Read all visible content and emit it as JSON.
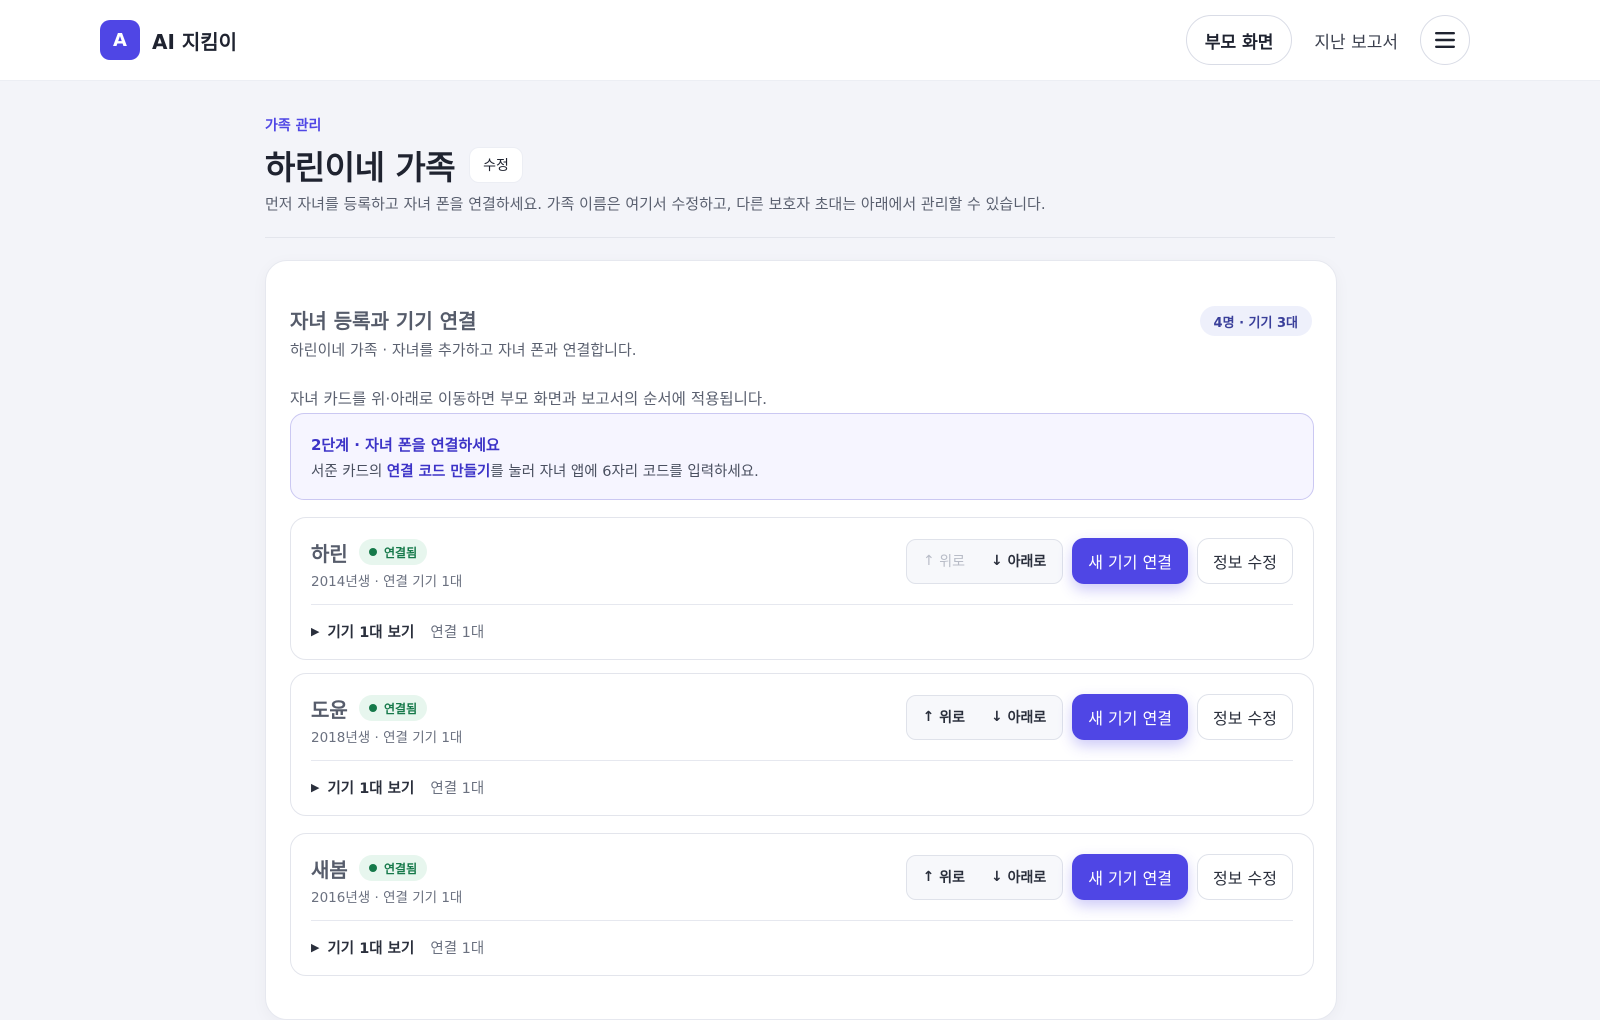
{
  "header": {
    "logo_letter": "A",
    "app_name": "AI 지킴이",
    "nav": {
      "parent_screen": "부모 화면",
      "past_reports": "지난 보고서"
    }
  },
  "page": {
    "eyebrow": "가족 관리",
    "title": "하린이네 가족",
    "edit_label": "수정",
    "description": "먼저 자녀를 등록하고 자녀 폰을 연결하세요. 가족 이름은 여기서 수정하고, 다른 보호자 초대는 아래에서 관리할 수 있습니다."
  },
  "section": {
    "title": "자녀 등록과 기기 연결",
    "subtitle": "하린이네 가족 · 자녀를 추가하고 자녀 폰과 연결합니다.",
    "count_badge": "4명 · 기기 3대",
    "order_note": "자녀 카드를 위·아래로 이동하면 부모 화면과 보고서의 순서에 적용됩니다."
  },
  "step": {
    "title": "2단계 · 자녀 폰을 연결하세요",
    "desc_prefix": "서준 카드의 ",
    "desc_highlight": "연결 코드 만들기",
    "desc_suffix": "를 눌러 자녀 앱에 6자리 코드를 입력하세요."
  },
  "children": [
    {
      "name": "하린",
      "status": "연결됨",
      "meta": "2014년생 · 연결 기기 1대",
      "up_label": "위로",
      "down_label": "아래로",
      "up_disabled": true,
      "connect_label": "새 기기 연결",
      "edit_label": "정보 수정",
      "devices_toggle": "기기 1대 보기",
      "devices_count": "연결 1대"
    },
    {
      "name": "도윤",
      "status": "연결됨",
      "meta": "2018년생 · 연결 기기 1대",
      "up_label": "위로",
      "down_label": "아래로",
      "up_disabled": false,
      "connect_label": "새 기기 연결",
      "edit_label": "정보 수정",
      "devices_toggle": "기기 1대 보기",
      "devices_count": "연결 1대"
    },
    {
      "name": "새봄",
      "status": "연결됨",
      "meta": "2016년생 · 연결 기기 1대",
      "up_label": "위로",
      "down_label": "아래로",
      "up_disabled": false,
      "connect_label": "새 기기 연결",
      "edit_label": "정보 수정",
      "devices_toggle": "기기 1대 보기",
      "devices_count": "연결 1대"
    }
  ]
}
